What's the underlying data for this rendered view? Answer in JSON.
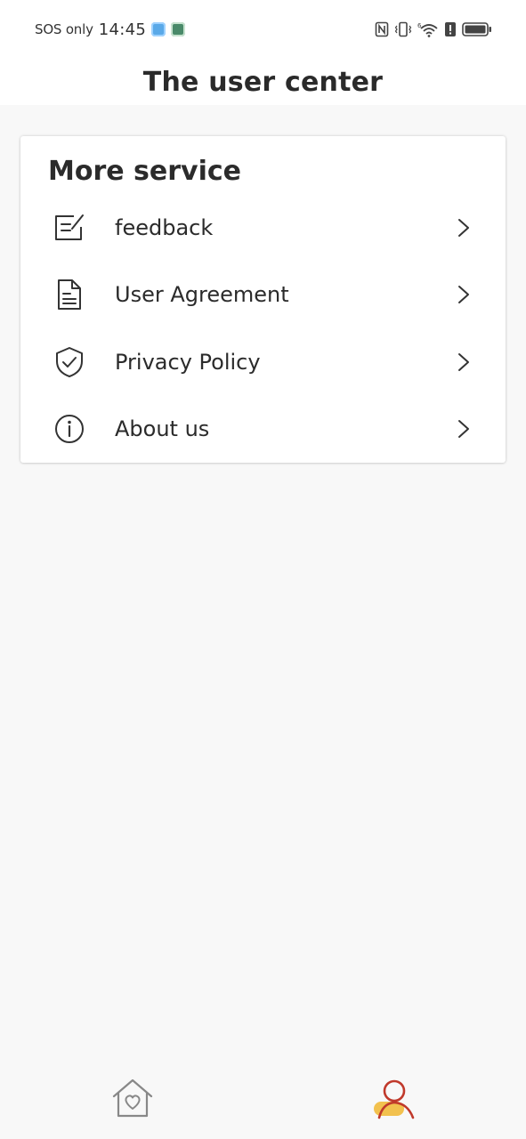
{
  "status_bar": {
    "carrier": "SOS only",
    "time": "14:45"
  },
  "header": {
    "title": "The user center"
  },
  "card": {
    "title": "More service",
    "items": [
      {
        "label": "feedback",
        "icon": "feedback-edit-icon"
      },
      {
        "label": "User Agreement",
        "icon": "document-icon"
      },
      {
        "label": "Privacy Policy",
        "icon": "shield-check-icon"
      },
      {
        "label": "About us",
        "icon": "info-icon"
      }
    ]
  },
  "bottom_nav": {
    "items": [
      {
        "icon": "home-heart-icon",
        "active": false
      },
      {
        "icon": "user-profile-icon",
        "active": true
      }
    ]
  },
  "colors": {
    "background": "#f8f8f8",
    "active_accent": "#c0392b",
    "active_accent_secondary": "#f2c14e",
    "inactive_icon": "#888888"
  }
}
